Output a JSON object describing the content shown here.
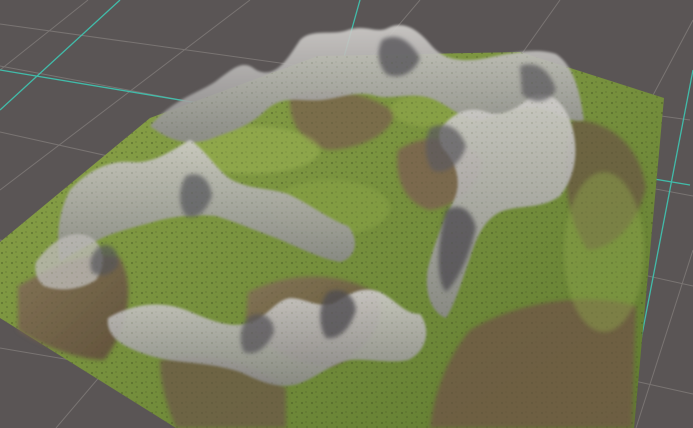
{
  "scene": {
    "type": "3d-terrain-viewport",
    "colors": {
      "background": "#5a5555",
      "grid_line": "#7f7a78",
      "grid_axis": "#3fc7b3",
      "grass": "#6f8a3a",
      "grass_light": "#8ea64a",
      "dirt": "#6e5a45",
      "rock": "#b9b6b2",
      "rock_shadow": "#5d5c5f"
    }
  }
}
